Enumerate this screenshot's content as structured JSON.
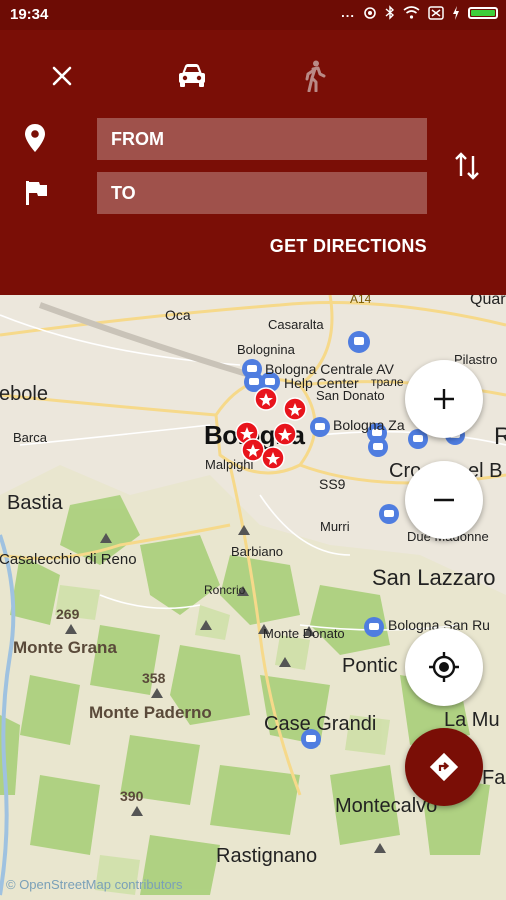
{
  "status_bar": {
    "time": "19:34",
    "dots": "..."
  },
  "header": {
    "from_placeholder": "FROM",
    "to_placeholder": "TO",
    "get_directions_label": "GET DIRECTIONS"
  },
  "map": {
    "labels": {
      "oca": "Oca",
      "casaralta": "Casaralta",
      "bolognina": "Bolognina",
      "bologna_centrale": "Bologna Centrale AV",
      "help_center": "Help Center",
      "help_center_suffix": "трале",
      "san_donato": "San Donato",
      "bologna_za": "Bologna Za",
      "ebole": "ebole",
      "barca": "Barca",
      "bologna": "Bologna",
      "malpighi": "Malpighi",
      "ss9": "SS9",
      "cro": "Cro",
      "del_b": "el B",
      "bastia": "Bastia",
      "murri": "Murri",
      "due_madonne": "Due Madonne",
      "casalecchio": "Casalecchio di Reno",
      "barbiano": "Barbiano",
      "san_lazzaro": "San Lazzaro",
      "roncrio": "Roncrio",
      "monte_donato": "Monte Donato",
      "bologna_san_ru": "Bologna San Ru",
      "e269": "269",
      "monte_grana": "Monte Grana",
      "pontic": "Pontic",
      "e358": "358",
      "monte_paderno": "Monte Paderno",
      "case_grandi": "Case Grandi",
      "la_mu": "La Mu",
      "fa": "Fa",
      "e390": "390",
      "montecalvo": "Montecalvo",
      "rastignano": "Rastignano",
      "pilastro": "Pilastro",
      "quar": "Quar",
      "r": "R",
      "a4": "A14"
    },
    "attribution": "© OpenStreetMap contributors"
  },
  "colors": {
    "header": "#7a0e06",
    "statusbar": "#6d0c05",
    "marker": "#e8141c",
    "transit": "#4f7de0",
    "park": "#a9cf7a"
  }
}
